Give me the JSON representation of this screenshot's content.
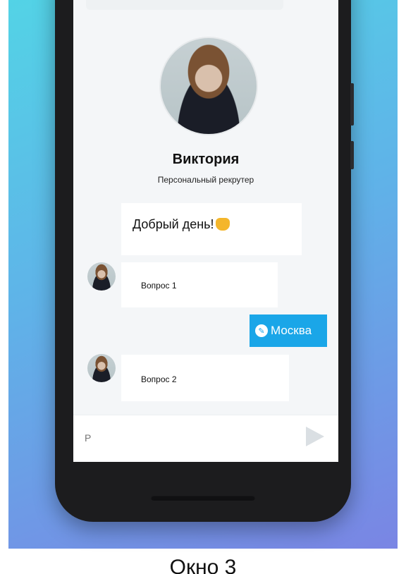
{
  "profile": {
    "name": "Виктория",
    "role": "Персональный рекрутер"
  },
  "messages": [
    {
      "from": "bot",
      "text": "Добрый день!"
    },
    {
      "from": "bot",
      "text": "Вопрос 1"
    },
    {
      "from": "user",
      "text": "Москва"
    },
    {
      "from": "bot",
      "text": "Вопрос 2"
    }
  ],
  "input": {
    "value": "",
    "placeholder": "Р"
  },
  "icons": {
    "send": "send-icon",
    "edit": "pencil-icon",
    "emoji": "raised-hands-emoji"
  },
  "colors": {
    "accent": "#1aa6e8",
    "gradient_start": "#53d3e6",
    "gradient_end": "#7a85e4"
  },
  "caption": "Окно 3"
}
